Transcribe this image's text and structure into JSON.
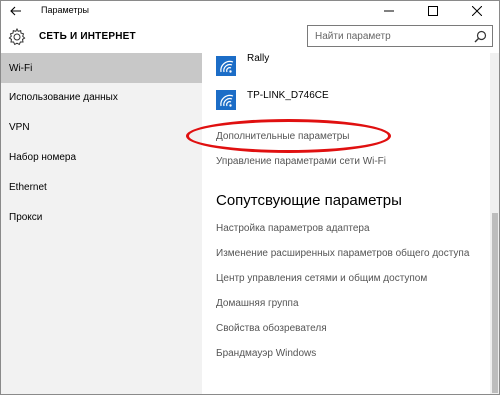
{
  "window": {
    "title": "Параметры"
  },
  "header": {
    "section_title": "СЕТЬ И ИНТЕРНЕТ",
    "search_placeholder": "Найти параметр"
  },
  "sidebar": {
    "items": [
      {
        "label": "Wi-Fi",
        "selected": true
      },
      {
        "label": "Использование данных",
        "selected": false
      },
      {
        "label": "VPN",
        "selected": false
      },
      {
        "label": "Набор номера",
        "selected": false
      },
      {
        "label": "Ethernet",
        "selected": false
      },
      {
        "label": "Прокси",
        "selected": false
      }
    ]
  },
  "main": {
    "networks": [
      {
        "name": "Rally",
        "icon": "wifi-signal-icon"
      },
      {
        "name": "TP-LINK_D746CE",
        "icon": "wifi-signal-icon"
      }
    ],
    "advanced_link": "Дополнительные параметры",
    "manage_link": "Управление параметрами сети Wi-Fi",
    "related_heading": "Сопутсвующие параметры",
    "related_links": [
      "Настройка параметров адаптера",
      "Изменение расширенных параметров общего доступа",
      "Центр управления сетями и общим доступом",
      "Домашняя группа",
      "Свойства обозревателя",
      "Брандмауэр Windows"
    ]
  },
  "colors": {
    "accent": "#1c6dc7",
    "highlight_ellipse": "#e01010",
    "selected_nav": "#c8c8c8",
    "sidebar_bg": "#f2f2f2"
  }
}
